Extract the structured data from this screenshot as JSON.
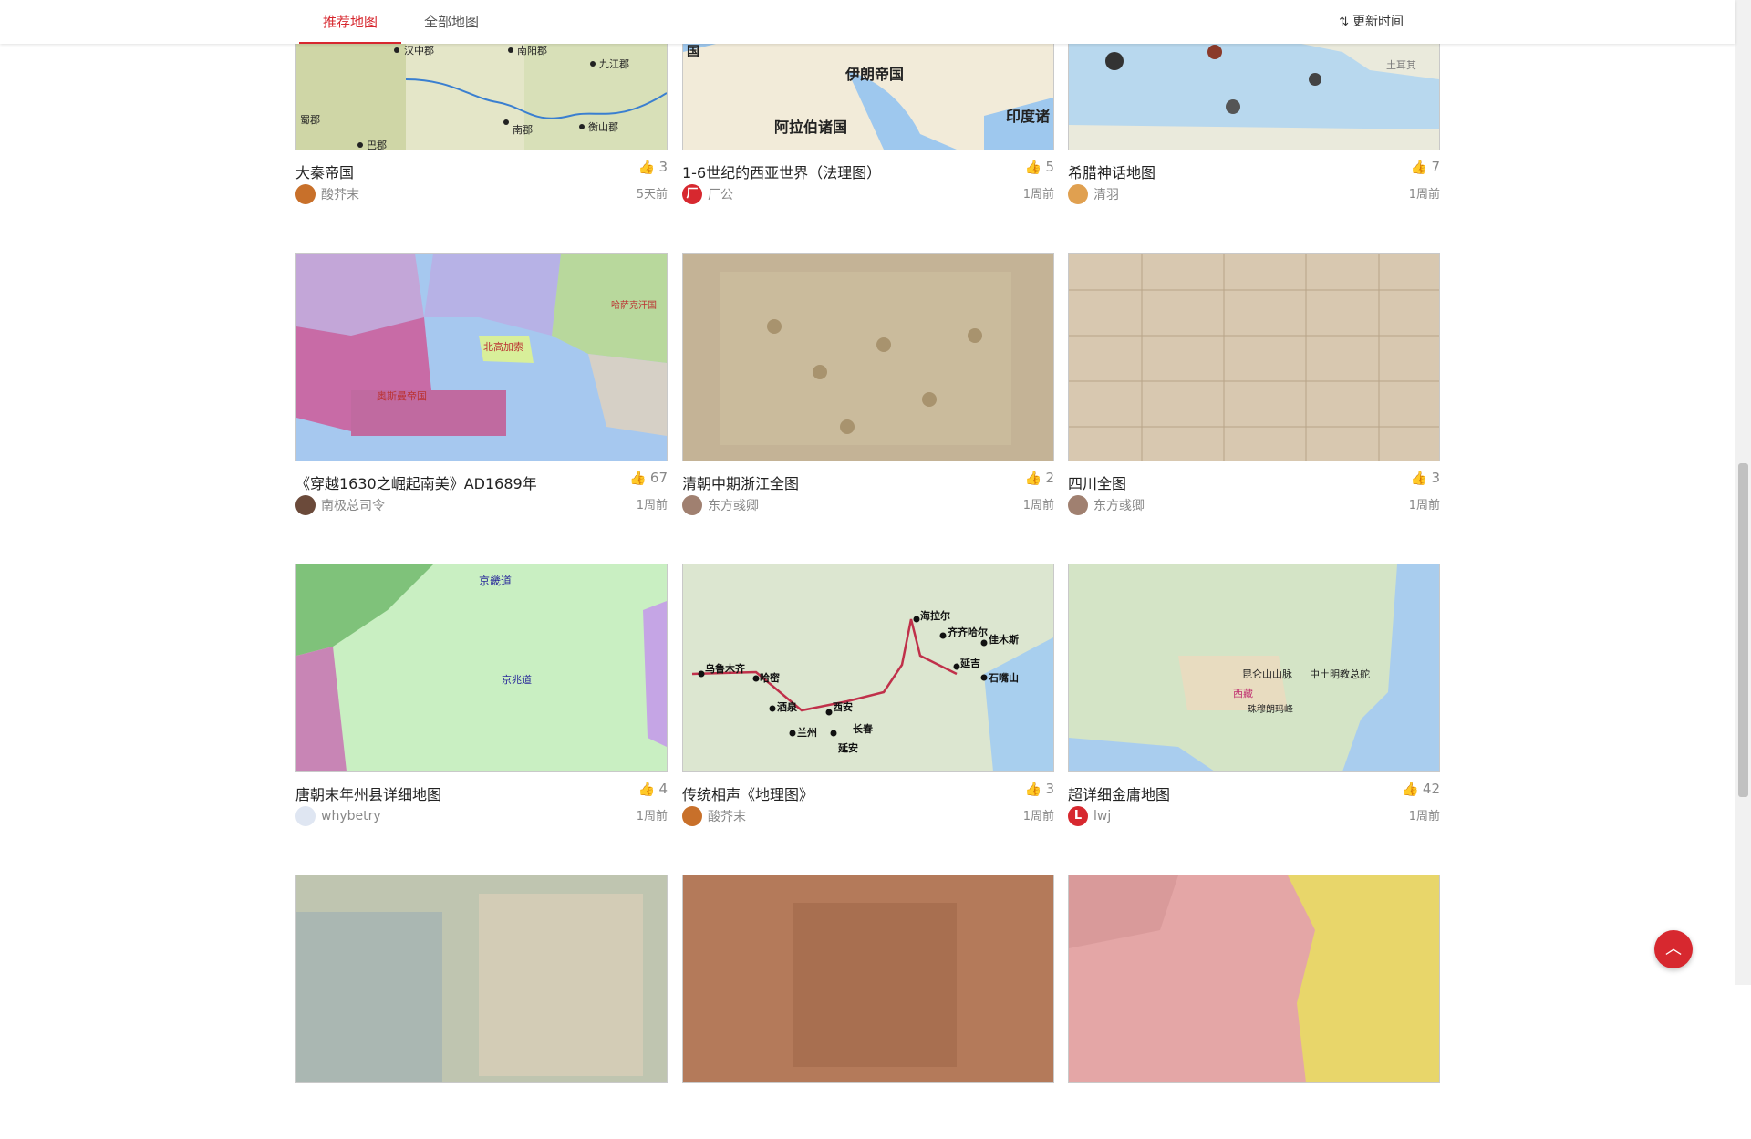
{
  "tabs": [
    {
      "label": "推荐地图",
      "active": true
    },
    {
      "label": "全部地图",
      "active": false
    }
  ],
  "sort": {
    "label": "更新时间",
    "icon": "sort-icon"
  },
  "cards": [
    {
      "title": "大秦帝国",
      "likes": "3",
      "author": "酸芥末",
      "time": "5天前",
      "avatar_color": "#c8702a",
      "avatar_letter": "",
      "labels": [
        "汉中郡",
        "南阳郡",
        "九江郡",
        "蜀郡",
        "南郡",
        "衡山郡",
        "巴郡"
      ]
    },
    {
      "title": "1-6世纪的西亚世界（法理图）",
      "likes": "5",
      "author": "厂公",
      "time": "1周前",
      "avatar_color": "#d7282f",
      "avatar_letter": "厂",
      "labels": [
        "伊朗帝国",
        "阿拉伯诸国",
        "印度诸",
        "国"
      ]
    },
    {
      "title": "希腊神话地图",
      "likes": "7",
      "author": "清羽",
      "time": "1周前",
      "avatar_color": "#e0a050",
      "avatar_letter": "",
      "labels": [
        "土耳其"
      ]
    },
    {
      "title": "《穿越1630之崛起南美》AD1689年",
      "likes": "67",
      "author": "南极总司令",
      "time": "1周前",
      "avatar_color": "#6b4a3a",
      "avatar_letter": "",
      "labels": [
        "北高加索",
        "哈萨克汗国",
        "奥斯曼帝国"
      ]
    },
    {
      "title": "清朝中期浙江全图",
      "likes": "2",
      "author": "东方彧卿",
      "time": "1周前",
      "avatar_color": "#a08070",
      "avatar_letter": "",
      "labels": []
    },
    {
      "title": "四川全图",
      "likes": "3",
      "author": "东方彧卿",
      "time": "1周前",
      "avatar_color": "#a08070",
      "avatar_letter": "",
      "labels": []
    },
    {
      "title": "唐朝末年州县详细地图",
      "likes": "4",
      "author": "whybetry",
      "time": "1周前",
      "avatar_color": "#dfe6f2",
      "avatar_letter": "",
      "labels": [
        "京畿道",
        "京兆道"
      ]
    },
    {
      "title": "传统相声《地理图》",
      "likes": "3",
      "author": "酸芥末",
      "time": "1周前",
      "avatar_color": "#c8702a",
      "avatar_letter": "",
      "labels": [
        "海拉尔",
        "齐齐哈尔",
        "佳木斯",
        "乌鲁木齐",
        "哈密",
        "酒泉",
        "兰州",
        "西安",
        "延安",
        "长春",
        "延吉",
        "石嘴山"
      ]
    },
    {
      "title": "超详细金庸地图",
      "likes": "42",
      "author": "lwj",
      "time": "1周前",
      "avatar_color": "#d7282f",
      "avatar_letter": "L",
      "labels": [
        "昆仑山山脉",
        "中土明教总舵",
        "西藏",
        "珠穆朗玛峰"
      ]
    },
    {
      "title": "",
      "likes": "",
      "author": "",
      "time": "",
      "avatar_color": "",
      "avatar_letter": "",
      "labels": []
    },
    {
      "title": "",
      "likes": "",
      "author": "",
      "time": "",
      "avatar_color": "",
      "avatar_letter": "",
      "labels": []
    },
    {
      "title": "",
      "likes": "",
      "author": "",
      "time": "",
      "avatar_color": "",
      "avatar_letter": "",
      "labels": []
    }
  ],
  "scroll_top_icon": "chevron-up-icon"
}
